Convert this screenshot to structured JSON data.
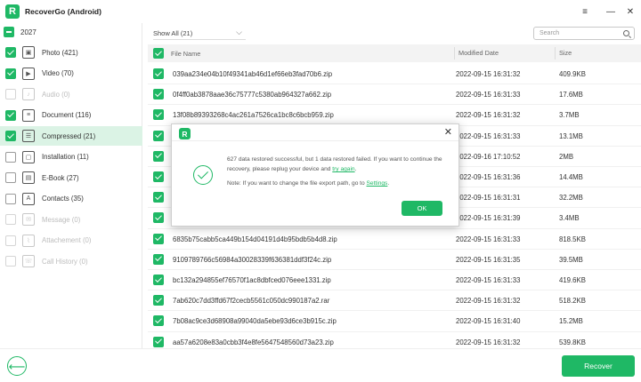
{
  "app": {
    "title": "RecoverGo (Android)",
    "logo_letter": "R"
  },
  "window_controls": {
    "menu": "≡",
    "minimize": "—",
    "close": "✕"
  },
  "sidebar": {
    "device": "2027",
    "items": [
      {
        "label": "Photo (421)",
        "icon": "photo-icon",
        "glyph": "▣",
        "state": "checked",
        "enabled": true
      },
      {
        "label": "Video (70)",
        "icon": "video-icon",
        "glyph": "▶",
        "state": "checked",
        "enabled": true
      },
      {
        "label": "Audio (0)",
        "icon": "audio-icon",
        "glyph": "♪",
        "state": "unchecked",
        "enabled": false
      },
      {
        "label": "Document (116)",
        "icon": "document-icon",
        "glyph": "≡",
        "state": "checked",
        "enabled": true
      },
      {
        "label": "Compressed (21)",
        "icon": "compressed-icon",
        "glyph": "☰",
        "state": "checked",
        "enabled": true
      },
      {
        "label": "Installation (11)",
        "icon": "installation-icon",
        "glyph": "▢",
        "state": "unchecked",
        "enabled": true
      },
      {
        "label": "E-Book (27)",
        "icon": "ebook-icon",
        "glyph": "▤",
        "state": "unchecked",
        "enabled": true
      },
      {
        "label": "Contacts (35)",
        "icon": "contacts-icon",
        "glyph": "A",
        "state": "unchecked",
        "enabled": true
      },
      {
        "label": "Message (0)",
        "icon": "message-icon",
        "glyph": "✉",
        "state": "unchecked",
        "enabled": false
      },
      {
        "label": "Attachement (0)",
        "icon": "attachment-icon",
        "glyph": "⌇",
        "state": "unchecked",
        "enabled": false
      },
      {
        "label": "Call History (0)",
        "icon": "call-history-icon",
        "glyph": "☏",
        "state": "unchecked",
        "enabled": false
      }
    ]
  },
  "toolbar": {
    "filter_value": "Show All (21)",
    "search_placeholder": "Search"
  },
  "table": {
    "headers": {
      "name": "File Name",
      "modified": "Modified Date",
      "size": "Size"
    },
    "rows": [
      {
        "name": "039aa234e04b10f49341ab46d1ef66eb3fad70b6.zip",
        "date": "2022-09-15 16:31:32",
        "size": "409.9KB"
      },
      {
        "name": "0f4ff0ab3878aae36c75777c5380ab964327a662.zip",
        "date": "2022-09-15 16:31:33",
        "size": "17.6MB"
      },
      {
        "name": "13f08b89393268c4ac261a7526ca1bc8c6bcb959.zip",
        "date": "2022-09-15 16:31:32",
        "size": "3.7MB"
      },
      {
        "name": "",
        "date": "2022-09-15 16:31:33",
        "size": "13.1MB"
      },
      {
        "name": "",
        "date": "2022-09-16 17:10:52",
        "size": "2MB"
      },
      {
        "name": "",
        "date": "2022-09-15 16:31:36",
        "size": "14.4MB"
      },
      {
        "name": "",
        "date": "2022-09-15 16:31:31",
        "size": "32.2MB"
      },
      {
        "name": "",
        "date": "2022-09-15 16:31:39",
        "size": "3.4MB"
      },
      {
        "name": "6835b75cabb5ca449b154d04191d4b95bdb5b4d8.zip",
        "date": "2022-09-15 16:31:33",
        "size": "818.5KB"
      },
      {
        "name": "9109789766c56984a30028339f636381ddf3f24c.zip",
        "date": "2022-09-15 16:31:35",
        "size": "39.5MB"
      },
      {
        "name": "bc132a294855ef76570f1ac8dbfced076eee1331.zip",
        "date": "2022-09-15 16:31:33",
        "size": "419.6KB"
      },
      {
        "name": "7ab620c7dd3ffd67f2cecb5561c050dc990187a2.rar",
        "date": "2022-09-15 16:31:32",
        "size": "518.2KB"
      },
      {
        "name": "7b08ac9ce3d68908a99040da5ebe93d6ce3b915c.zip",
        "date": "2022-09-15 16:31:40",
        "size": "15.2MB"
      },
      {
        "name": "aa57a6208e83a0cbb3f4e8fe5647548560d73a23.zip",
        "date": "2022-09-15 16:31:32",
        "size": "539.8KB"
      }
    ]
  },
  "dialog": {
    "logo_letter": "R",
    "close": "✕",
    "message_part1": "627 data restored successful, but 1 data restored failed. If you want to continue the recovery, please replug your device and",
    "message_link": "try again",
    "message_end": ".",
    "note_prefix": "Note: If you want to change the file export path, go to",
    "note_link": "Settings",
    "note_end": ".",
    "ok_label": "OK"
  },
  "footer": {
    "back_glyph": "⟵",
    "recover_label": "Recover"
  },
  "colors": {
    "accent": "#1fb865",
    "active_bg": "#dbf3e5"
  }
}
